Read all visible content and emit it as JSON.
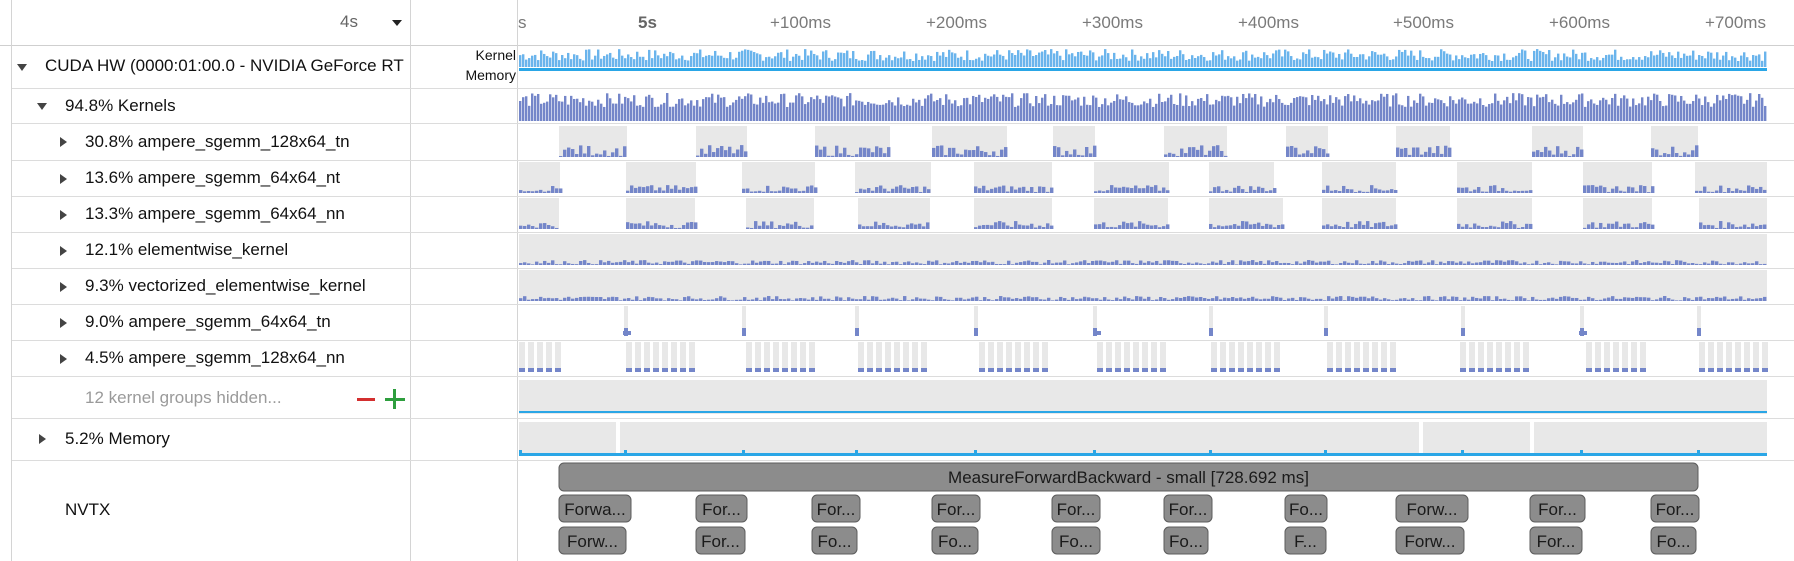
{
  "header": {
    "zoom_label": "4s",
    "ticks": [
      {
        "label": "s",
        "bold": false
      },
      {
        "label": "5s",
        "bold": true
      },
      {
        "label": "+100ms",
        "bold": false
      },
      {
        "label": "+200ms",
        "bold": false
      },
      {
        "label": "+300ms",
        "bold": false
      },
      {
        "label": "+400ms",
        "bold": false
      },
      {
        "label": "+500ms",
        "bold": false
      },
      {
        "label": "+600ms",
        "bold": false
      },
      {
        "label": "+700ms",
        "bold": false
      }
    ]
  },
  "tree": {
    "device_label": "CUDA HW (0000:01:00.0 - NVIDIA GeForce RT",
    "device_sub": {
      "kernel": "Kernel",
      "memory": "Memory"
    },
    "kernels_label": "94.8% Kernels",
    "kernel_rows": [
      "30.8% ampere_sgemm_128x64_tn",
      "13.6% ampere_sgemm_64x64_nt",
      "13.3% ampere_sgemm_64x64_nn",
      "12.1% elementwise_kernel",
      "9.3% vectorized_elementwise_kernel",
      "9.0% ampere_sgemm_64x64_tn",
      "4.5% ampere_sgemm_128x64_nn"
    ],
    "hidden_label": "12 kernel groups hidden...",
    "memory_label": "5.2% Memory",
    "nvtx_label": "NVTX"
  },
  "nvtx": {
    "main_range": "MeasureForwardBackward - small [728.692 ms]",
    "level2": [
      "Forwa...",
      "For...",
      "For...",
      "For...",
      "For...",
      "For...",
      "Fo...",
      "Forw...",
      "For...",
      "For..."
    ],
    "level3": [
      "Forw...",
      "For...",
      "Fo...",
      "Fo...",
      "Fo...",
      "Fo...",
      "F...",
      "Forw...",
      "For...",
      "Fo..."
    ]
  },
  "colors": {
    "kernel_bar": "#7486c9",
    "kernel_summary": "#6ab4ec",
    "memory_line": "#2aa6e6",
    "range_bg": "#e8e8e8",
    "nvtx_box": "#8c8c8c"
  }
}
